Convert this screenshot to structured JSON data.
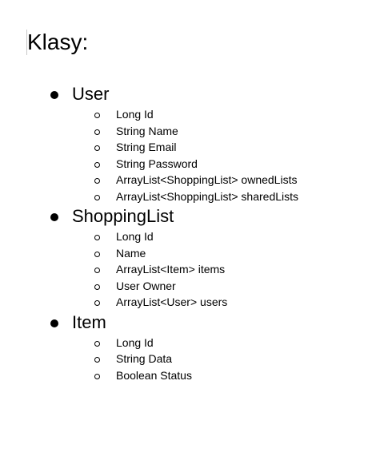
{
  "document": {
    "title": "Klasy:",
    "classes": [
      {
        "name": "User",
        "fields": [
          "Long Id",
          "String Name",
          "String Email",
          "String Password",
          "ArrayList<ShoppingList> ownedLists",
          "ArrayList<ShoppingList> sharedLists"
        ]
      },
      {
        "name": "ShoppingList",
        "fields": [
          "Long Id",
          "Name",
          "ArrayList<Item> items",
          "User Owner",
          "ArrayList<User> users"
        ]
      },
      {
        "name": "Item",
        "fields": [
          "Long Id",
          "String Data",
          "Boolean Status"
        ]
      }
    ]
  }
}
